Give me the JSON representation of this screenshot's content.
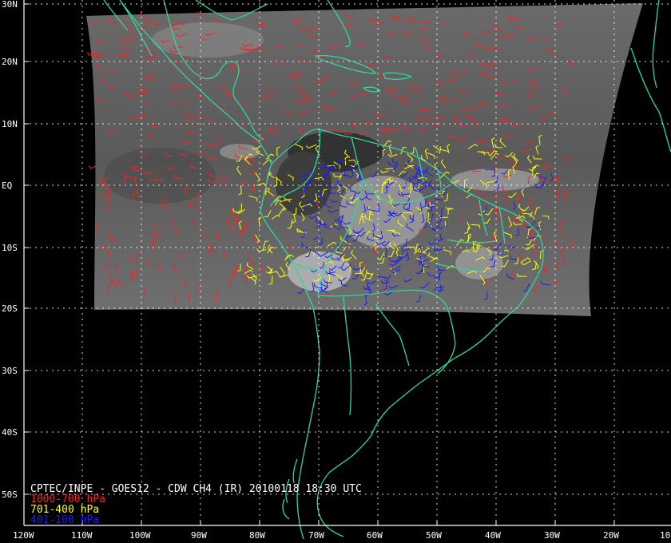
{
  "colors": {
    "background": "#000000",
    "coast": "#2fd6a0",
    "grid": "#ffffff",
    "low_level": "#ff2020",
    "mid_level": "#ffff00",
    "high_level": "#1a1aff"
  },
  "latitude_labels": [
    "30N",
    "20N",
    "10N",
    "EQ",
    "10S",
    "20S",
    "30S",
    "40S",
    "50S"
  ],
  "longitude_labels": [
    "120W",
    "110W",
    "100W",
    "90W",
    "80W",
    "70W",
    "60W",
    "50W",
    "40W",
    "30W",
    "20W",
    "10"
  ],
  "title": "CPTEC/INPE - GOES12 - CDW CH4 (IR) 20100118 18:30 UTC",
  "legend": [
    {
      "label": "1000-700 hPa",
      "color_key": "low_level"
    },
    {
      "label": "701-400 hPa",
      "color_key": "mid_level"
    },
    {
      "label": "401-100 hPa",
      "color_key": "high_level"
    }
  ]
}
